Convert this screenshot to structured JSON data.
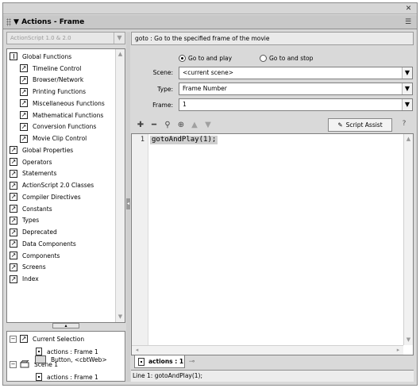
{
  "panel": {
    "close_glyph": "✕",
    "collapse_glyph": "▼",
    "title": "Actions - Frame",
    "menu_glyph": "☰"
  },
  "toolbox": {
    "version_label": "ActionScript 1.0 & 2.0",
    "items": [
      {
        "label": "Global Functions",
        "expanded": true
      },
      {
        "label": "Timeline Control"
      },
      {
        "label": "Browser/Network"
      },
      {
        "label": "Printing Functions"
      },
      {
        "label": "Miscellaneous Functions"
      },
      {
        "label": "Mathematical Functions"
      },
      {
        "label": "Conversion Functions"
      },
      {
        "label": "Movie Clip Control"
      },
      {
        "label": "Global Properties"
      },
      {
        "label": "Operators"
      },
      {
        "label": "Statements"
      },
      {
        "label": "ActionScript 2.0 Classes"
      },
      {
        "label": "Compiler Directives"
      },
      {
        "label": "Constants"
      },
      {
        "label": "Types"
      },
      {
        "label": "Deprecated"
      },
      {
        "label": "Data Components"
      },
      {
        "label": "Components"
      },
      {
        "label": "Screens"
      },
      {
        "label": "Index"
      }
    ]
  },
  "script_navigator": {
    "current_selection_label": "Current Selection",
    "current_selection_item": "actions : Frame 1",
    "scene_label": "Scene 1",
    "scene_item_frame": "actions : Frame 1",
    "scene_item_button": "Button, <cbtWeb>"
  },
  "info": {
    "text": "goto : Go to the specified frame of the movie"
  },
  "params": {
    "radio_play_label": "Go to and play",
    "radio_stop_label": "Go to and stop",
    "selected_radio": "Go to and play",
    "scene_label": "Scene:",
    "scene_value": "<current scene>",
    "type_label": "Type:",
    "type_value": "Frame Number",
    "frame_label": "Frame:",
    "frame_value": "1"
  },
  "toolbar": {
    "script_assist_label": "Script Assist"
  },
  "editor": {
    "line_number": "1",
    "code": "gotoAndPlay(1);"
  },
  "tabs": {
    "active_label": "actions : 1"
  },
  "status": {
    "text": "Line 1: gotoAndPlay(1);"
  }
}
